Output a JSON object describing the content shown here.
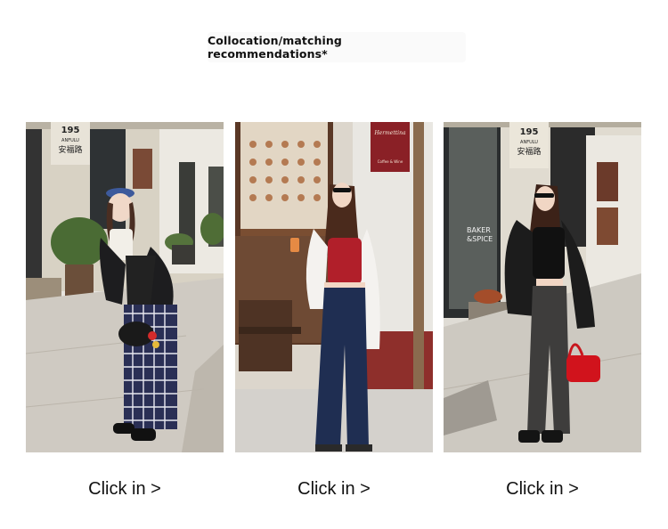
{
  "header": {
    "title": "Collocation/matching recommendations*"
  },
  "cards": [
    {
      "link_label": "Click in >",
      "sign_text": [
        "195",
        "ANFULU",
        "安福路"
      ]
    },
    {
      "link_label": "Click in >",
      "sign_text": [
        "Hermettina",
        "Coffee & Wine"
      ]
    },
    {
      "link_label": "Click in >",
      "sign_text": [
        "195",
        "ANFULU",
        "安福路"
      ],
      "window_text": [
        "BAKER",
        "&SPICE"
      ]
    }
  ]
}
